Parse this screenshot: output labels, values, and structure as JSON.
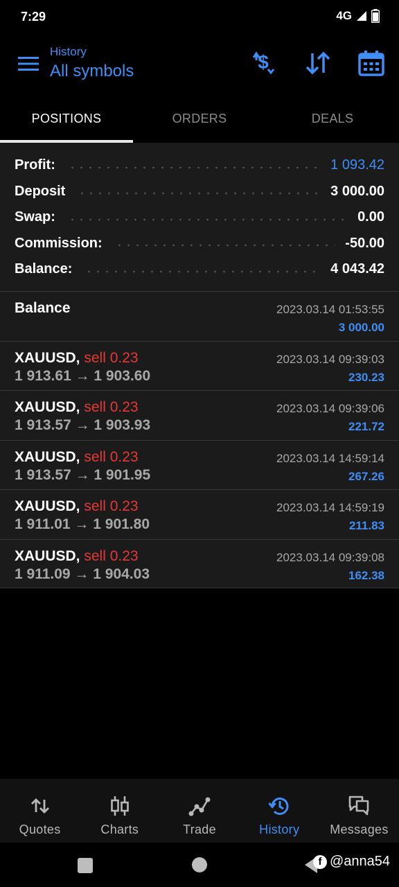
{
  "status_bar": {
    "time": "7:29",
    "network": "4G"
  },
  "header": {
    "subtitle": "History",
    "title": "All symbols"
  },
  "toolbar": {
    "icons": [
      "dollar-exchange-icon",
      "sort-icon",
      "calendar-icon"
    ]
  },
  "tabs": [
    {
      "label": "POSITIONS",
      "active": true
    },
    {
      "label": "ORDERS",
      "active": false
    },
    {
      "label": "DEALS",
      "active": false
    }
  ],
  "summary": {
    "profit": {
      "label": "Profit:",
      "value": "1 093.42"
    },
    "deposit": {
      "label": "Deposit",
      "value": "3 000.00"
    },
    "swap": {
      "label": "Swap:",
      "value": "0.00"
    },
    "commission": {
      "label": "Commission:",
      "value": "-50.00"
    },
    "balance": {
      "label": "Balance:",
      "value": "4 043.42"
    }
  },
  "balance_entry": {
    "title": "Balance",
    "time": "2023.03.14 01:53:55",
    "amount": "3 000.00"
  },
  "positions": [
    {
      "symbol": "XAUUSD,",
      "type": "sell 0.23",
      "prices": "1 913.61 → 1 903.60",
      "time": "2023.03.14 09:39:03",
      "profit": "230.23"
    },
    {
      "symbol": "XAUUSD,",
      "type": "sell 0.23",
      "prices": "1 913.57 → 1 903.93",
      "time": "2023.03.14 09:39:06",
      "profit": "221.72"
    },
    {
      "symbol": "XAUUSD,",
      "type": "sell 0.23",
      "prices": "1 913.57 → 1 901.95",
      "time": "2023.03.14 14:59:14",
      "profit": "267.26"
    },
    {
      "symbol": "XAUUSD,",
      "type": "sell 0.23",
      "prices": "1 911.01 → 1 901.80",
      "time": "2023.03.14 14:59:19",
      "profit": "211.83"
    },
    {
      "symbol": "XAUUSD,",
      "type": "sell 0.23",
      "prices": "1 911.09 → 1 904.03",
      "time": "2023.03.14 09:39:08",
      "profit": "162.38"
    }
  ],
  "bottom_nav": [
    {
      "label": "Quotes",
      "icon": "quotes-icon",
      "active": false
    },
    {
      "label": "Charts",
      "icon": "charts-icon",
      "active": false
    },
    {
      "label": "Trade",
      "icon": "trade-icon",
      "active": false
    },
    {
      "label": "History",
      "icon": "history-icon",
      "active": true
    },
    {
      "label": "Messages",
      "icon": "messages-icon",
      "active": false
    }
  ],
  "watermark": {
    "badge": "f",
    "text": "@anna54"
  },
  "colors": {
    "accent": "#3f8ef5",
    "sell": "#e53935",
    "panel": "#1b1b1b",
    "background": "#000000"
  }
}
